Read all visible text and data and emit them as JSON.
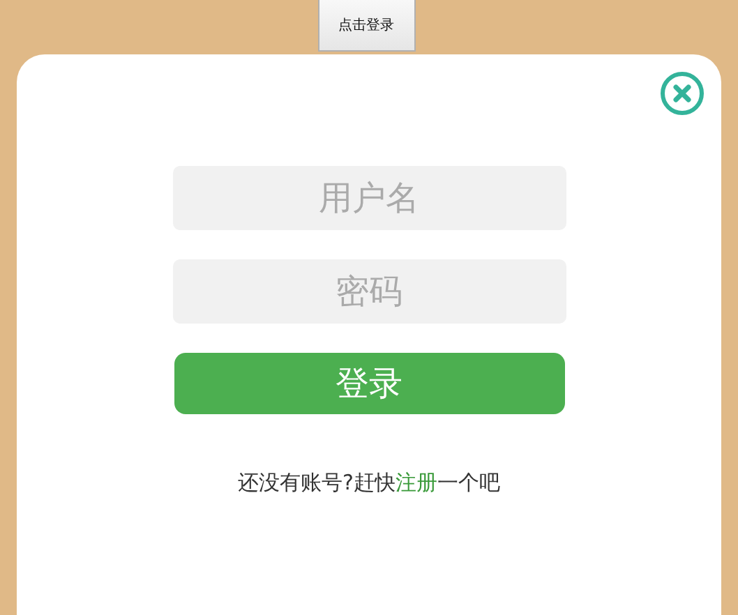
{
  "top_button": "点击登录",
  "modal": {
    "fields": [
      {
        "placeholder": "用户名"
      },
      {
        "placeholder": "密码"
      }
    ],
    "submit": "登录",
    "prompt": {
      "before": "还没有账号?赶快",
      "link": "注册",
      "after": "一个吧"
    }
  }
}
